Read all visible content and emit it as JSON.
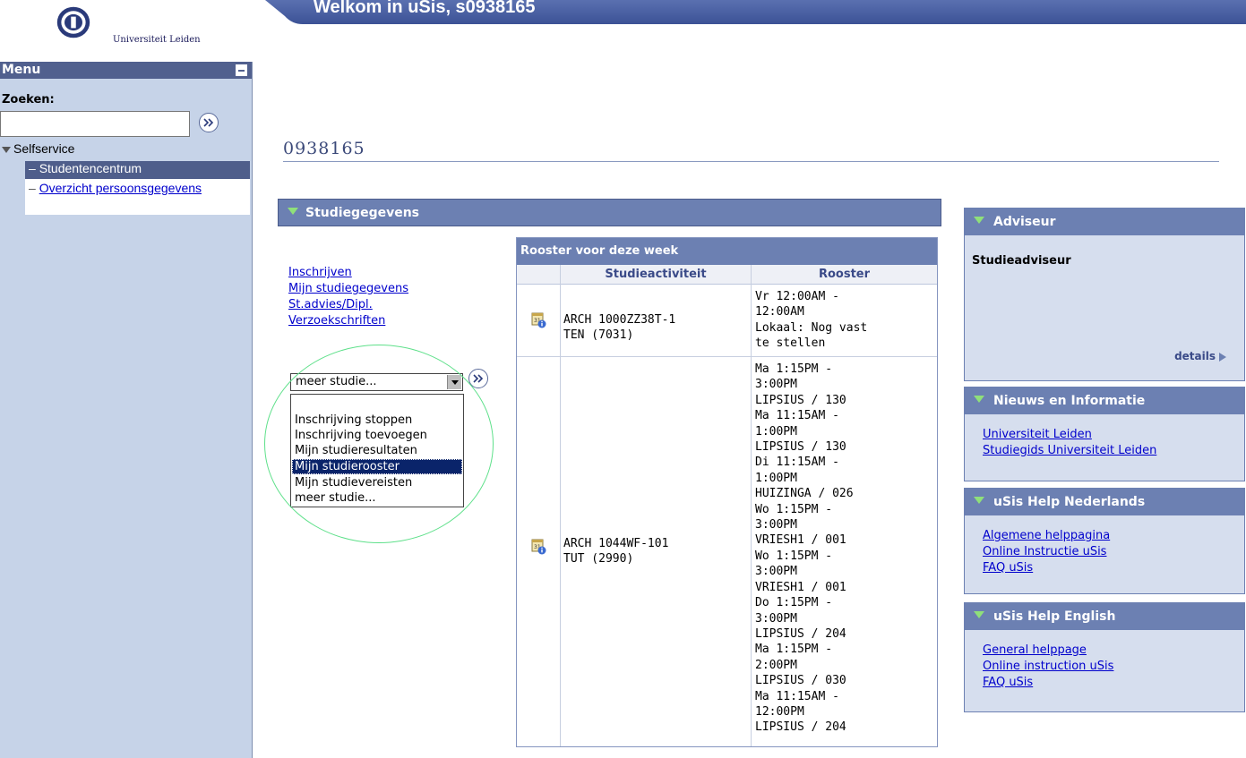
{
  "header": {
    "university_name": "Universiteit Leiden",
    "welcome": "Welkom in uSis, s0938165"
  },
  "sidebar": {
    "menu_title": "Menu",
    "search_label": "Zoeken:",
    "search_value": "",
    "tree": {
      "root": "Selfservice",
      "items": [
        {
          "label": "Studentencentrum",
          "active": true
        },
        {
          "label": "Overzicht persoonsgegevens",
          "active": false
        }
      ]
    }
  },
  "main": {
    "page_title": "0938165",
    "studie_section": "Studiegegevens",
    "links": [
      "Inschrijven",
      "Mijn studiegegevens",
      "St.advies/Dipl.",
      "Verzoekschriften"
    ],
    "dropdown": {
      "selected": "meer studie...",
      "options": [
        "",
        "Inschrijving stoppen",
        "Inschrijving toevoegen",
        "Mijn studieresultaten",
        "Mijn studierooster",
        "Mijn studievereisten",
        "meer studie..."
      ],
      "highlighted_index": 4
    },
    "rooster": {
      "caption": "Rooster voor deze week",
      "col_activity": "Studieactiviteit",
      "col_schedule": "Rooster",
      "rows": [
        {
          "activity_line1": "ARCH 1000ZZ38T-1",
          "activity_line2": "TEN (7031)",
          "schedule": [
            "Vr 12:00AM -",
            "12:00AM",
            "Lokaal: Nog vast",
            "te stellen"
          ]
        },
        {
          "activity_line1": "ARCH 1044WF-101",
          "activity_line2": "TUT (2990)",
          "schedule": [
            "Ma 1:15PM -",
            "3:00PM",
            "LIPSIUS / 130",
            "Ma 11:15AM -",
            "1:00PM",
            "LIPSIUS / 130",
            "Di 11:15AM -",
            "1:00PM",
            "HUIZINGA / 026",
            "Wo 1:15PM -",
            "3:00PM",
            "VRIESH1 / 001",
            "Wo 1:15PM -",
            "3:00PM",
            "VRIESH1 / 001",
            "Do 1:15PM -",
            "3:00PM",
            "LIPSIUS / 204",
            "Ma 1:15PM -",
            "2:00PM",
            "LIPSIUS / 030",
            "Ma 11:15AM -",
            "12:00PM",
            "LIPSIUS / 204"
          ]
        }
      ]
    }
  },
  "right": {
    "adviseur": {
      "title": "Adviseur",
      "content": "Studieadviseur",
      "details": "details"
    },
    "nieuws": {
      "title": "Nieuws en Informatie",
      "links": [
        "Universiteit Leiden",
        "Studiegids Universiteit Leiden"
      ]
    },
    "help_nl": {
      "title": "uSis Help Nederlands",
      "links": [
        "Algemene helppagina",
        "Online Instructie uSis",
        "FAQ uSis"
      ]
    },
    "help_en": {
      "title": "uSis Help English",
      "links": [
        "General helppage",
        "Online instruction uSis",
        "FAQ uSis"
      ]
    }
  },
  "colors": {
    "accent": "#6c80b2",
    "menu_header": "#51608e",
    "sidebar_bg": "#c6d3e8",
    "link": "#0000cc"
  }
}
